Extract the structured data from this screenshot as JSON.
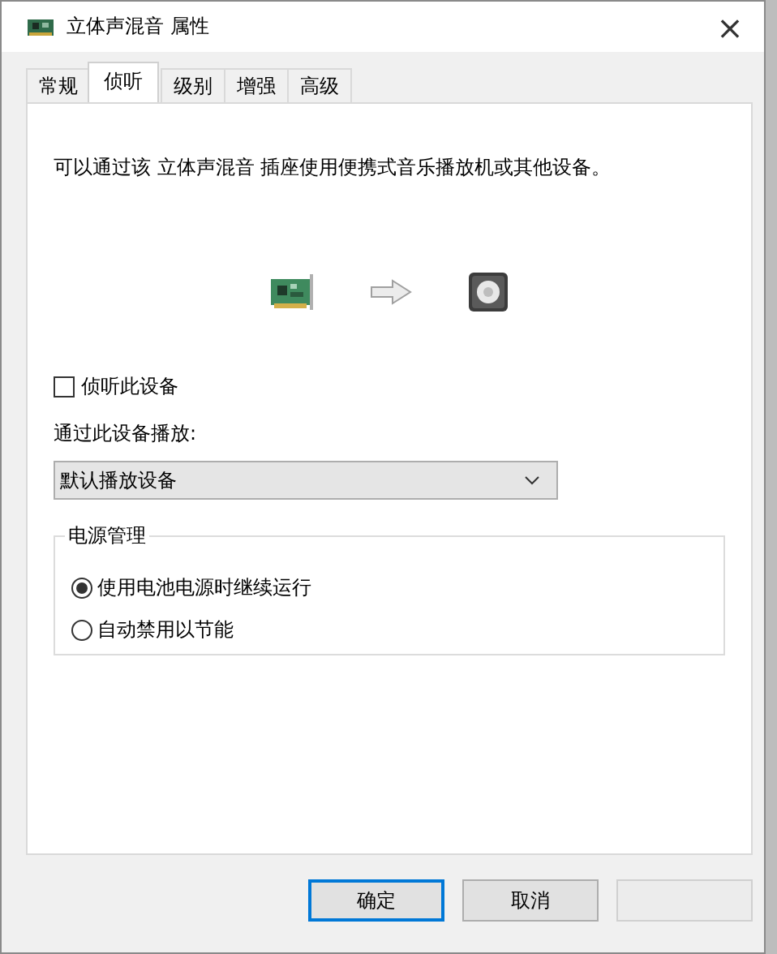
{
  "window": {
    "title": "立体声混音 属性",
    "close": "×"
  },
  "tabs": [
    {
      "label": "常规",
      "selected": false
    },
    {
      "label": "侦听",
      "selected": true
    },
    {
      "label": "级别",
      "selected": false
    },
    {
      "label": "增强",
      "selected": false
    },
    {
      "label": "高级",
      "selected": false
    }
  ],
  "description": "可以通过该 立体声混音 插座使用便携式音乐播放机或其他设备。",
  "listen_checkbox": {
    "label": "侦听此设备",
    "checked": false
  },
  "playback_label": "通过此设备播放:",
  "playback_dropdown": {
    "value": "默认播放设备"
  },
  "power_group": {
    "title": "电源管理",
    "options": [
      {
        "label": "使用电池电源时继续运行",
        "selected": true
      },
      {
        "label": "自动禁用以节能",
        "selected": false
      }
    ]
  },
  "buttons": [
    {
      "label": "确定",
      "default": true,
      "disabled": false
    },
    {
      "label": "取消",
      "default": false,
      "disabled": false
    },
    {
      "default": false,
      "disabled": true
    }
  ]
}
